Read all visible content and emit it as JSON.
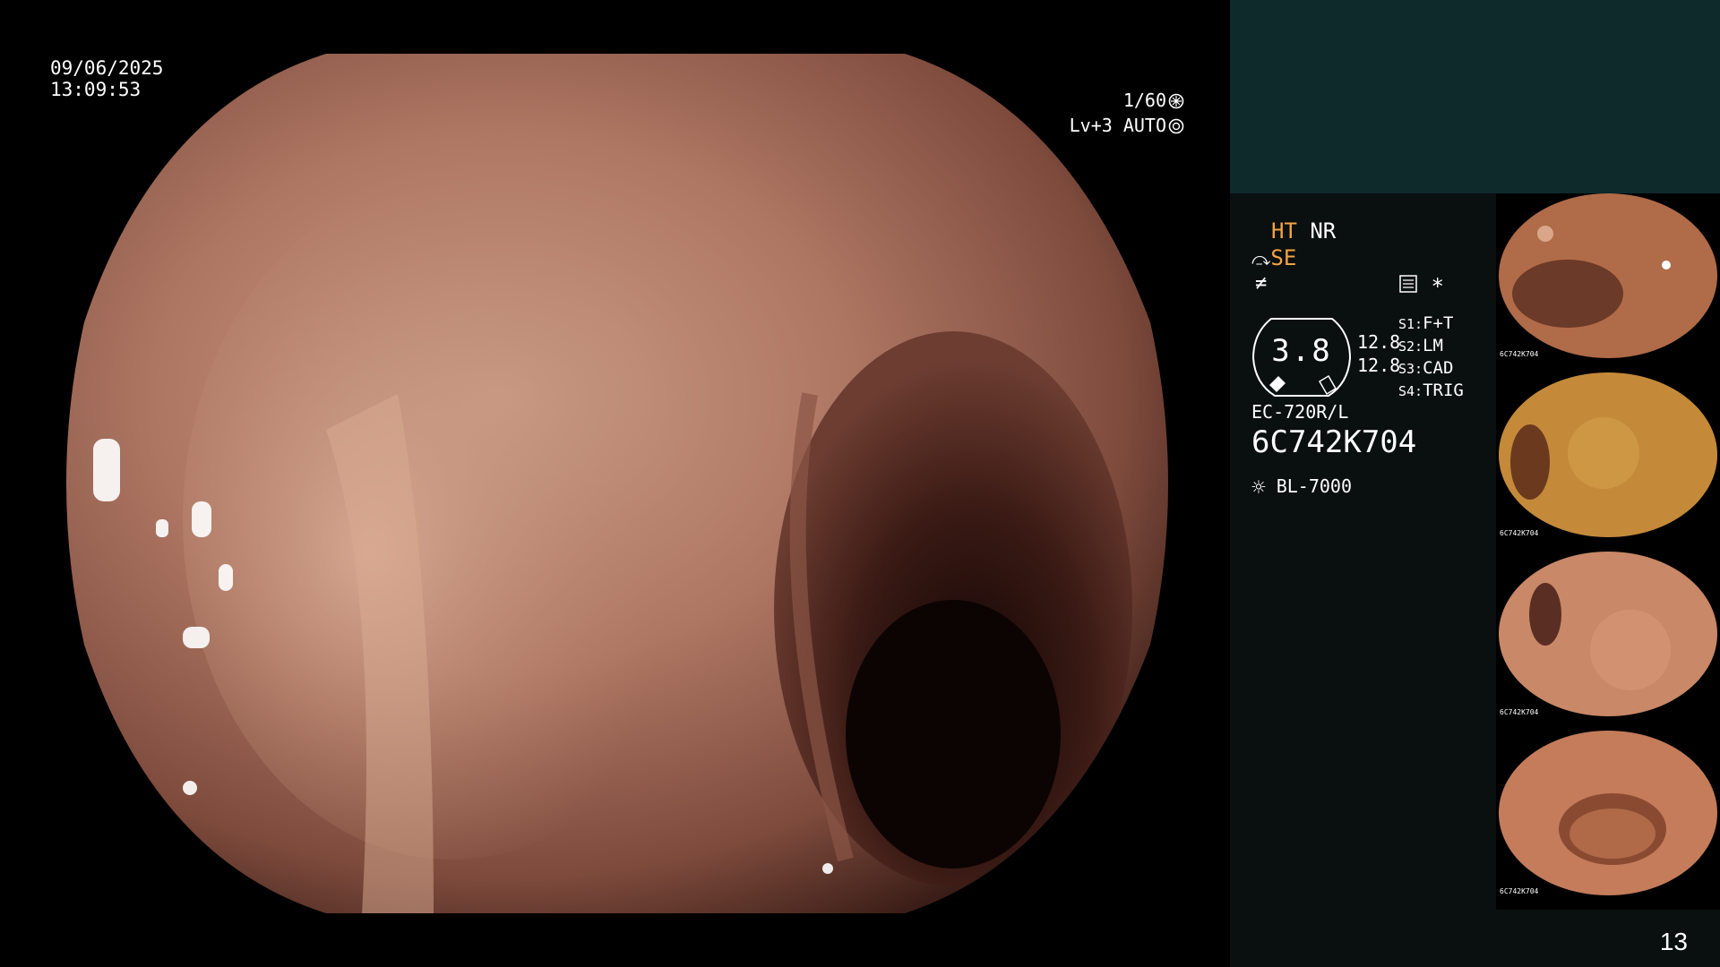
{
  "osd": {
    "date": "09/06/2025",
    "time": "13:09:53",
    "shutter": "1/60",
    "level": "Lv+3",
    "iris": "AUTO"
  },
  "panel": {
    "ht": "HT",
    "nr": "NR",
    "se": "SE",
    "gauge_value": "3.8",
    "val1": "12.8",
    "val2": "12.8",
    "s1_label": "S1:",
    "s1": "F+T",
    "s2_label": "S2:",
    "s2": "LM",
    "s3_label": "S3:",
    "s3": "CAD",
    "s4_label": "S4:",
    "s4": "TRIG",
    "scope_model": "EC-720R/L",
    "serial": "6C742K704",
    "light_source": "BL-7000",
    "asterisk": "*"
  },
  "thumbnails": [
    {
      "serial": "6C742K704"
    },
    {
      "serial": "6C742K704"
    },
    {
      "serial": "6C742K704"
    },
    {
      "serial": "6C742K704"
    }
  ],
  "page_number": "13",
  "colors": {
    "accent": "#f5a340",
    "panel_top": "#0e2a2b",
    "panel_bg": "#0a0f10"
  }
}
